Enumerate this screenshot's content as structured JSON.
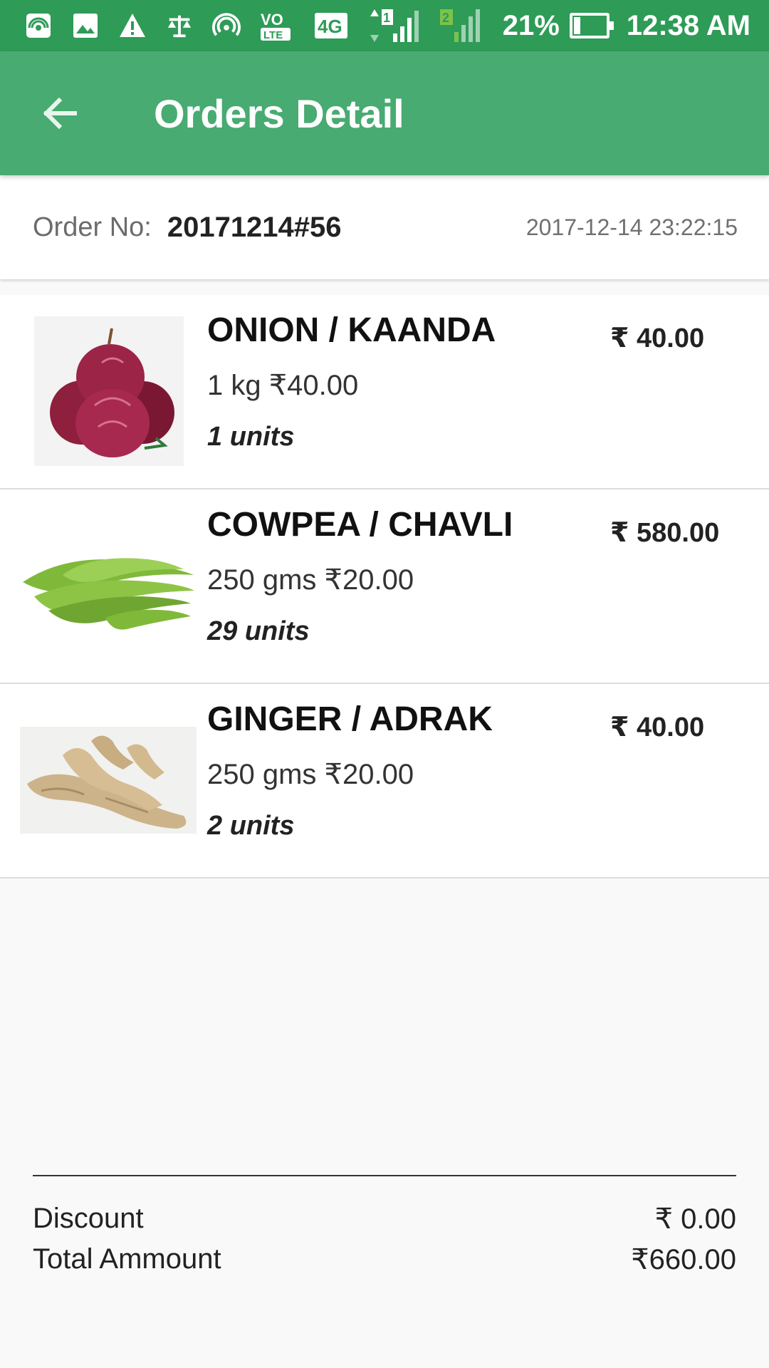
{
  "status_bar": {
    "icons": [
      "hotspot-icon",
      "image-icon",
      "warning-icon",
      "scale-icon",
      "wifi-hotspot-icon",
      "volte-icon",
      "4g-icon",
      "signal-1-icon",
      "signal-2-icon"
    ],
    "volte_label": "VO LTE",
    "network_label": "4G",
    "battery_percent": "21%",
    "battery_level": 0.21,
    "time": "12:38 AM"
  },
  "app_bar": {
    "title": "Orders Detail",
    "back_icon": "arrow-left-icon"
  },
  "order": {
    "label": "Order No:",
    "number": "20171214#56",
    "datetime": "2017-12-14 23:22:15"
  },
  "items": [
    {
      "name": "ONION / KAANDA",
      "quantity": "1 kg ₹40.00",
      "units": "1 units",
      "price": "₹ 40.00",
      "image_icon": "onion-image"
    },
    {
      "name": "COWPEA / CHAVLI",
      "quantity": "250 gms ₹20.00",
      "units": "29 units",
      "price": "₹ 580.00",
      "image_icon": "cowpea-image"
    },
    {
      "name": "GINGER / ADRAK",
      "quantity": "250 gms ₹20.00",
      "units": "2 units",
      "price": "₹ 40.00",
      "image_icon": "ginger-image"
    }
  ],
  "summary": {
    "discount_label": "Discount",
    "discount_value": "₹ 0.00",
    "total_label": "Total Ammount",
    "total_value": "₹660.00"
  },
  "colors": {
    "status_bar": "#2e9b57",
    "app_bar": "#48ab71",
    "background": "#f9f9f9"
  }
}
